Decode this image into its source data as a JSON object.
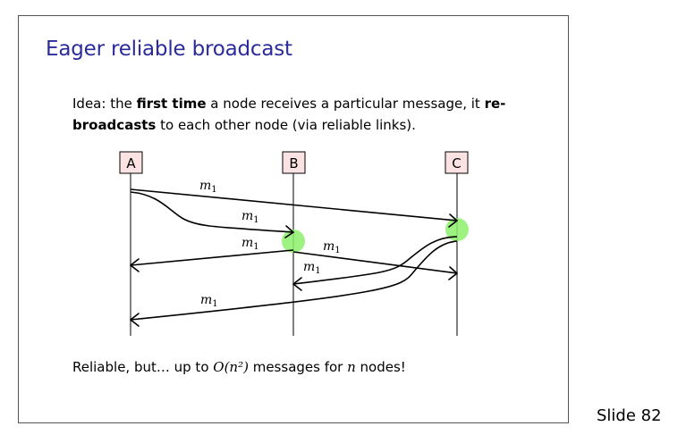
{
  "title": "Eager reliable broadcast",
  "idea": {
    "p1": "Idea: the ",
    "b1": "first time",
    "p2": " a node receives a particular message, it ",
    "b2": "re-broadcasts",
    "p3": " to each other node (via reliable links)."
  },
  "diagram": {
    "nodes": [
      "A",
      "B",
      "C"
    ],
    "message_label": "m",
    "message_subscript": "1"
  },
  "summary": {
    "p1": "Reliable, but…  up to ",
    "math1": "O(n²)",
    "p2": " messages for ",
    "math2": "n",
    "p3": " nodes!"
  },
  "slide_number": "Slide 82",
  "colors": {
    "title": "#2b2b9c",
    "node_fill": "#fbe3e3",
    "receive_highlight": "#8cf06b"
  }
}
